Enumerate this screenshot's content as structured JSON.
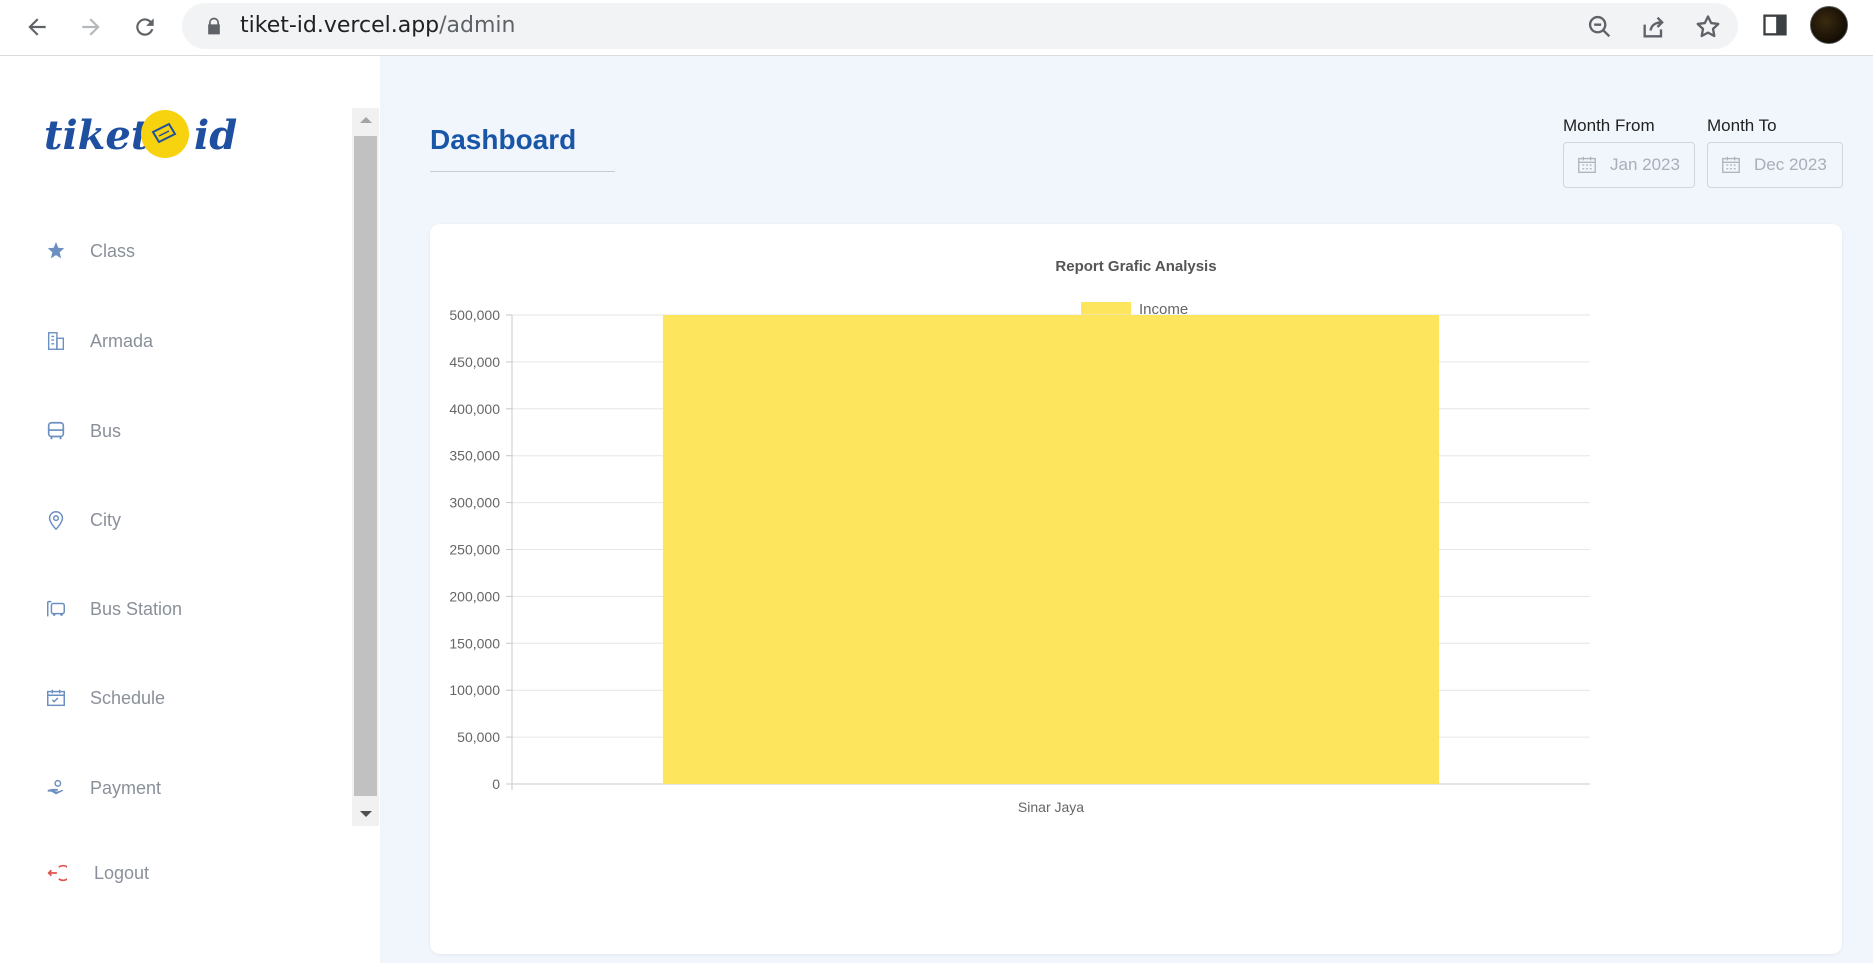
{
  "browser": {
    "url_host": "tiket-id.vercel.app",
    "url_path": "/admin",
    "icons": [
      "back-arrow-icon",
      "forward-arrow-icon",
      "reload-icon",
      "lock-icon",
      "zoom-out-icon",
      "share-icon",
      "star-icon",
      "side-panel-icon",
      "profile-avatar"
    ]
  },
  "brand": {
    "logo_left": "tiket",
    "logo_right": "id"
  },
  "sidebar": {
    "items": [
      {
        "label": "Class",
        "icon": "class-icon"
      },
      {
        "label": "Armada",
        "icon": "building-icon"
      },
      {
        "label": "Bus",
        "icon": "bus-icon"
      },
      {
        "label": "City",
        "icon": "location-pin-icon"
      },
      {
        "label": "Bus Station",
        "icon": "bus-station-icon"
      },
      {
        "label": "Schedule",
        "icon": "calendar-icon"
      },
      {
        "label": "Payment",
        "icon": "payment-hand-icon"
      }
    ],
    "logout_label": "Logout"
  },
  "header": {
    "title": "Dashboard",
    "month_from_label": "Month From",
    "month_from_value": "Jan 2023",
    "month_to_label": "Month To",
    "month_to_value": "Dec 2023"
  },
  "colors": {
    "accent": "#1a56a8",
    "bar": "#fde55e",
    "logout_icon": "#e0524e",
    "menu_icon": "#6b8fc0"
  },
  "chart_data": {
    "type": "bar",
    "title": "Report Grafic Analysis",
    "categories": [
      "Sinar Jaya"
    ],
    "series": [
      {
        "name": "Income",
        "values": [
          500000
        ]
      }
    ],
    "y_ticks": [
      "0",
      "50,000",
      "100,000",
      "150,000",
      "200,000",
      "250,000",
      "300,000",
      "350,000",
      "400,000",
      "450,000",
      "500,000"
    ],
    "ylim": [
      0,
      500000
    ],
    "grid": true,
    "legend_position": "top"
  }
}
